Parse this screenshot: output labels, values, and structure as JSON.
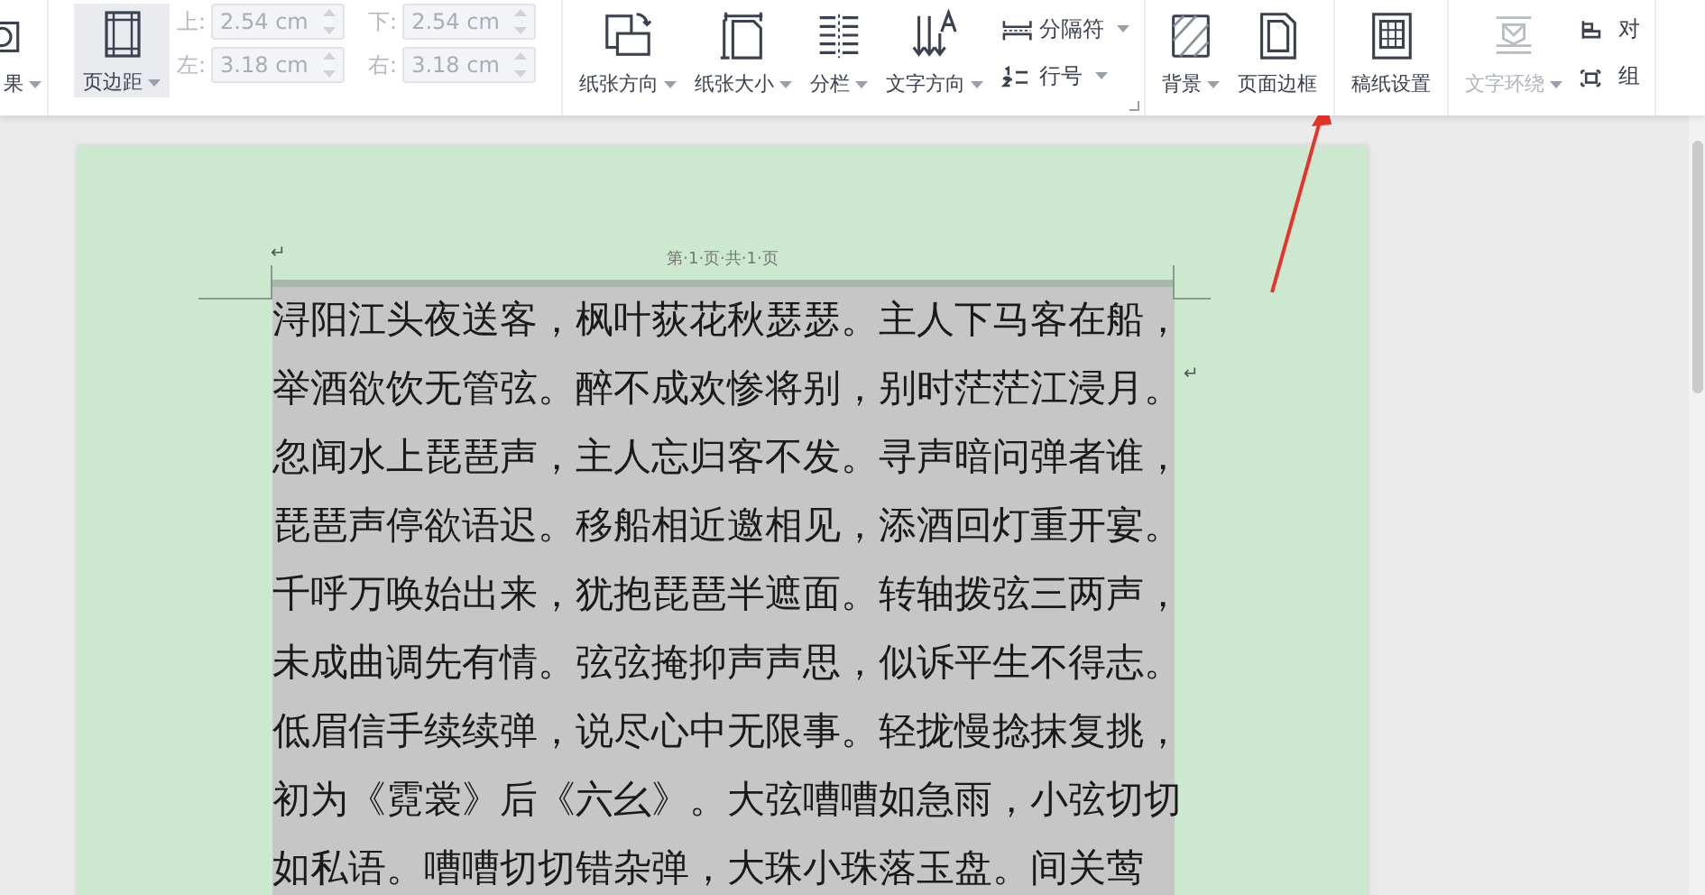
{
  "toolbar": {
    "cut_item": {
      "label": "果",
      "dropdown": true
    },
    "margin_button": {
      "label": "页边距",
      "selected": true,
      "dropdown": true
    },
    "margin_fields": [
      {
        "label": "上:",
        "value": "2.54 cm",
        "disabled": true
      },
      {
        "label": "下:",
        "value": "2.54 cm",
        "disabled": true
      },
      {
        "label": "左:",
        "value": "3.18 cm",
        "disabled": true
      },
      {
        "label": "右:",
        "value": "3.18 cm",
        "disabled": true
      }
    ],
    "groups": [
      {
        "items": [
          {
            "kind": "large",
            "label": "纸张方向",
            "dropdown": true,
            "disabled": false
          },
          {
            "kind": "large",
            "label": "纸张大小",
            "dropdown": true,
            "disabled": false
          },
          {
            "kind": "large",
            "label": "分栏",
            "dropdown": true,
            "disabled": false
          },
          {
            "kind": "large",
            "label": "文字方向",
            "dropdown": true,
            "disabled": false
          },
          {
            "kind": "stack",
            "entries": [
              {
                "label": "分隔符",
                "dropdown": true
              },
              {
                "label": "行号",
                "dropdown": true
              }
            ]
          }
        ],
        "launcher": true
      },
      {
        "items": [
          {
            "kind": "large",
            "label": "背景",
            "dropdown": true,
            "disabled": false
          },
          {
            "kind": "large",
            "label": "页面边框",
            "dropdown": false,
            "disabled": false
          }
        ]
      },
      {
        "items": [
          {
            "kind": "large",
            "label": "稿纸设置",
            "dropdown": false,
            "disabled": false
          }
        ]
      },
      {
        "items": [
          {
            "kind": "large",
            "label": "文字环绕",
            "dropdown": true,
            "disabled": true
          },
          {
            "kind": "stack",
            "entries": [
              {
                "label": "对"
              },
              {
                "label": "组"
              }
            ]
          }
        ]
      }
    ]
  },
  "page": {
    "header_mark": "↵",
    "header": "第·1·页·共·1·页",
    "selected": true,
    "paragraphs": [
      {
        "lines": [
          "浔阳江头夜送客，枫叶荻花秋瑟瑟。主人下马客在船，",
          "举酒欲饮无管弦。醉不成欢惨将别，别时茫茫江浸月。"
        ],
        "end_mark": "↵"
      },
      {
        "lines": [
          "忽闻水上琵琶声，主人忘归客不发。寻声暗问弹者谁，",
          "琵琶声停欲语迟。移船相近邀相见，添酒回灯重开宴。",
          "千呼万唤始出来，犹抱琵琶半遮面。转轴拨弦三两声，",
          "未成曲调先有情。弦弦掩抑声声思，似诉平生不得志。",
          "低眉信手续续弹，说尽心中无限事。轻拢慢捻抹复挑，",
          "初为《霓裳》后《六幺》。大弦嘈嘈如急雨，小弦切切",
          "如私语。嘈嘈切切错杂弹，大珠小珠落玉盘。间关莺"
        ]
      }
    ]
  }
}
